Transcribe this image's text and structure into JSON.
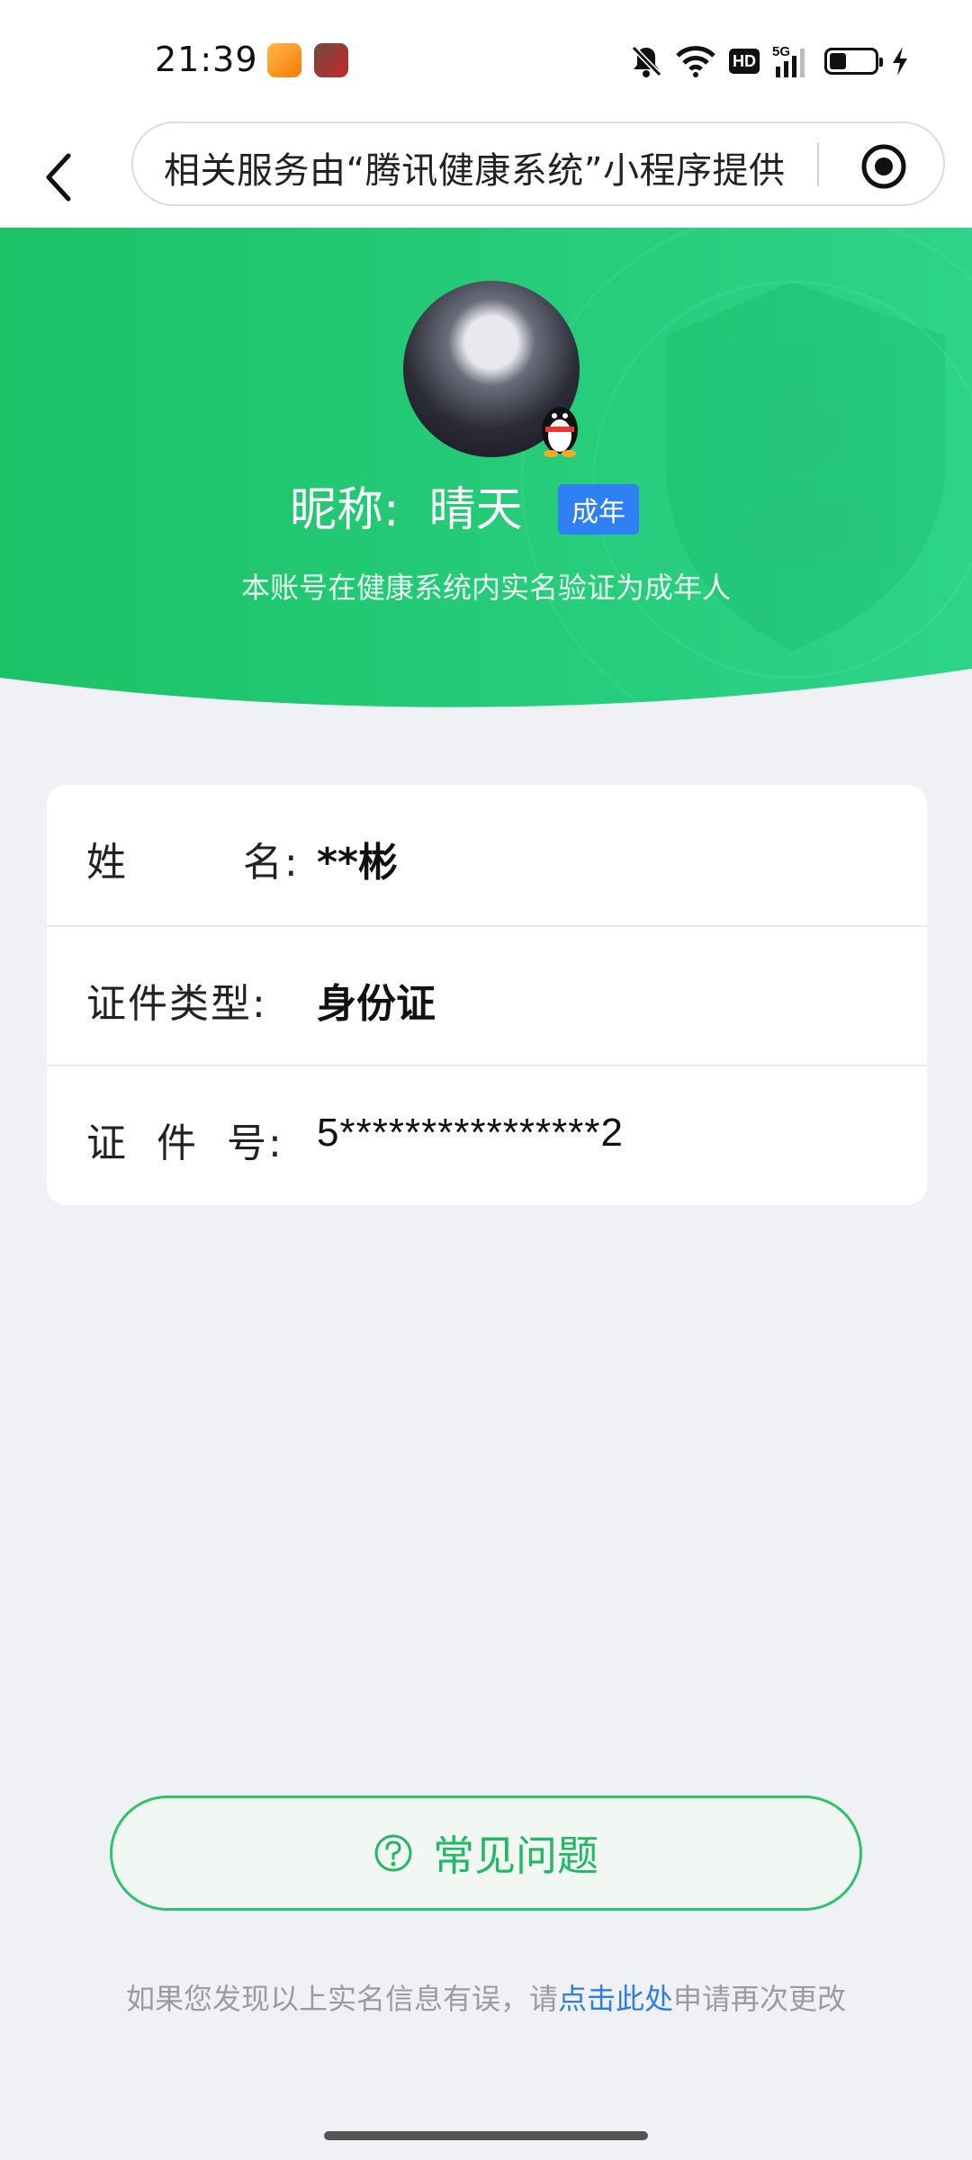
{
  "status_bar": {
    "time": "21:39",
    "icons": [
      "mute-icon",
      "wifi-icon",
      "hd-icon",
      "5g-signal-icon",
      "battery-icon",
      "charging-icon"
    ],
    "hd_label": "HD"
  },
  "nav": {
    "url_text": "相关服务由“腾讯健康系统”小程序提供",
    "back_icon": "back-arrow-icon",
    "record_icon": "record-icon"
  },
  "profile": {
    "nickname_label": "昵称:",
    "nickname": "晴天",
    "badge": "成年",
    "subtitle": "本账号在健康系统内实名验证为成年人"
  },
  "info": {
    "rows": [
      {
        "label": "姓        名:",
        "value": "**彬"
      },
      {
        "label": "证件类型:",
        "value": "身份证"
      },
      {
        "label": "证  件  号:",
        "value": "5****************2"
      }
    ]
  },
  "faq": {
    "label": "常见问题"
  },
  "footer": {
    "prefix": "如果您发现以上实名信息有误，请",
    "link": "点击此处",
    "suffix": "申请再次更改"
  },
  "colors": {
    "green": "#1fca72",
    "badge_blue": "#2f7ff5",
    "link_blue": "#2d7ee5",
    "background": "#eff1f5"
  }
}
